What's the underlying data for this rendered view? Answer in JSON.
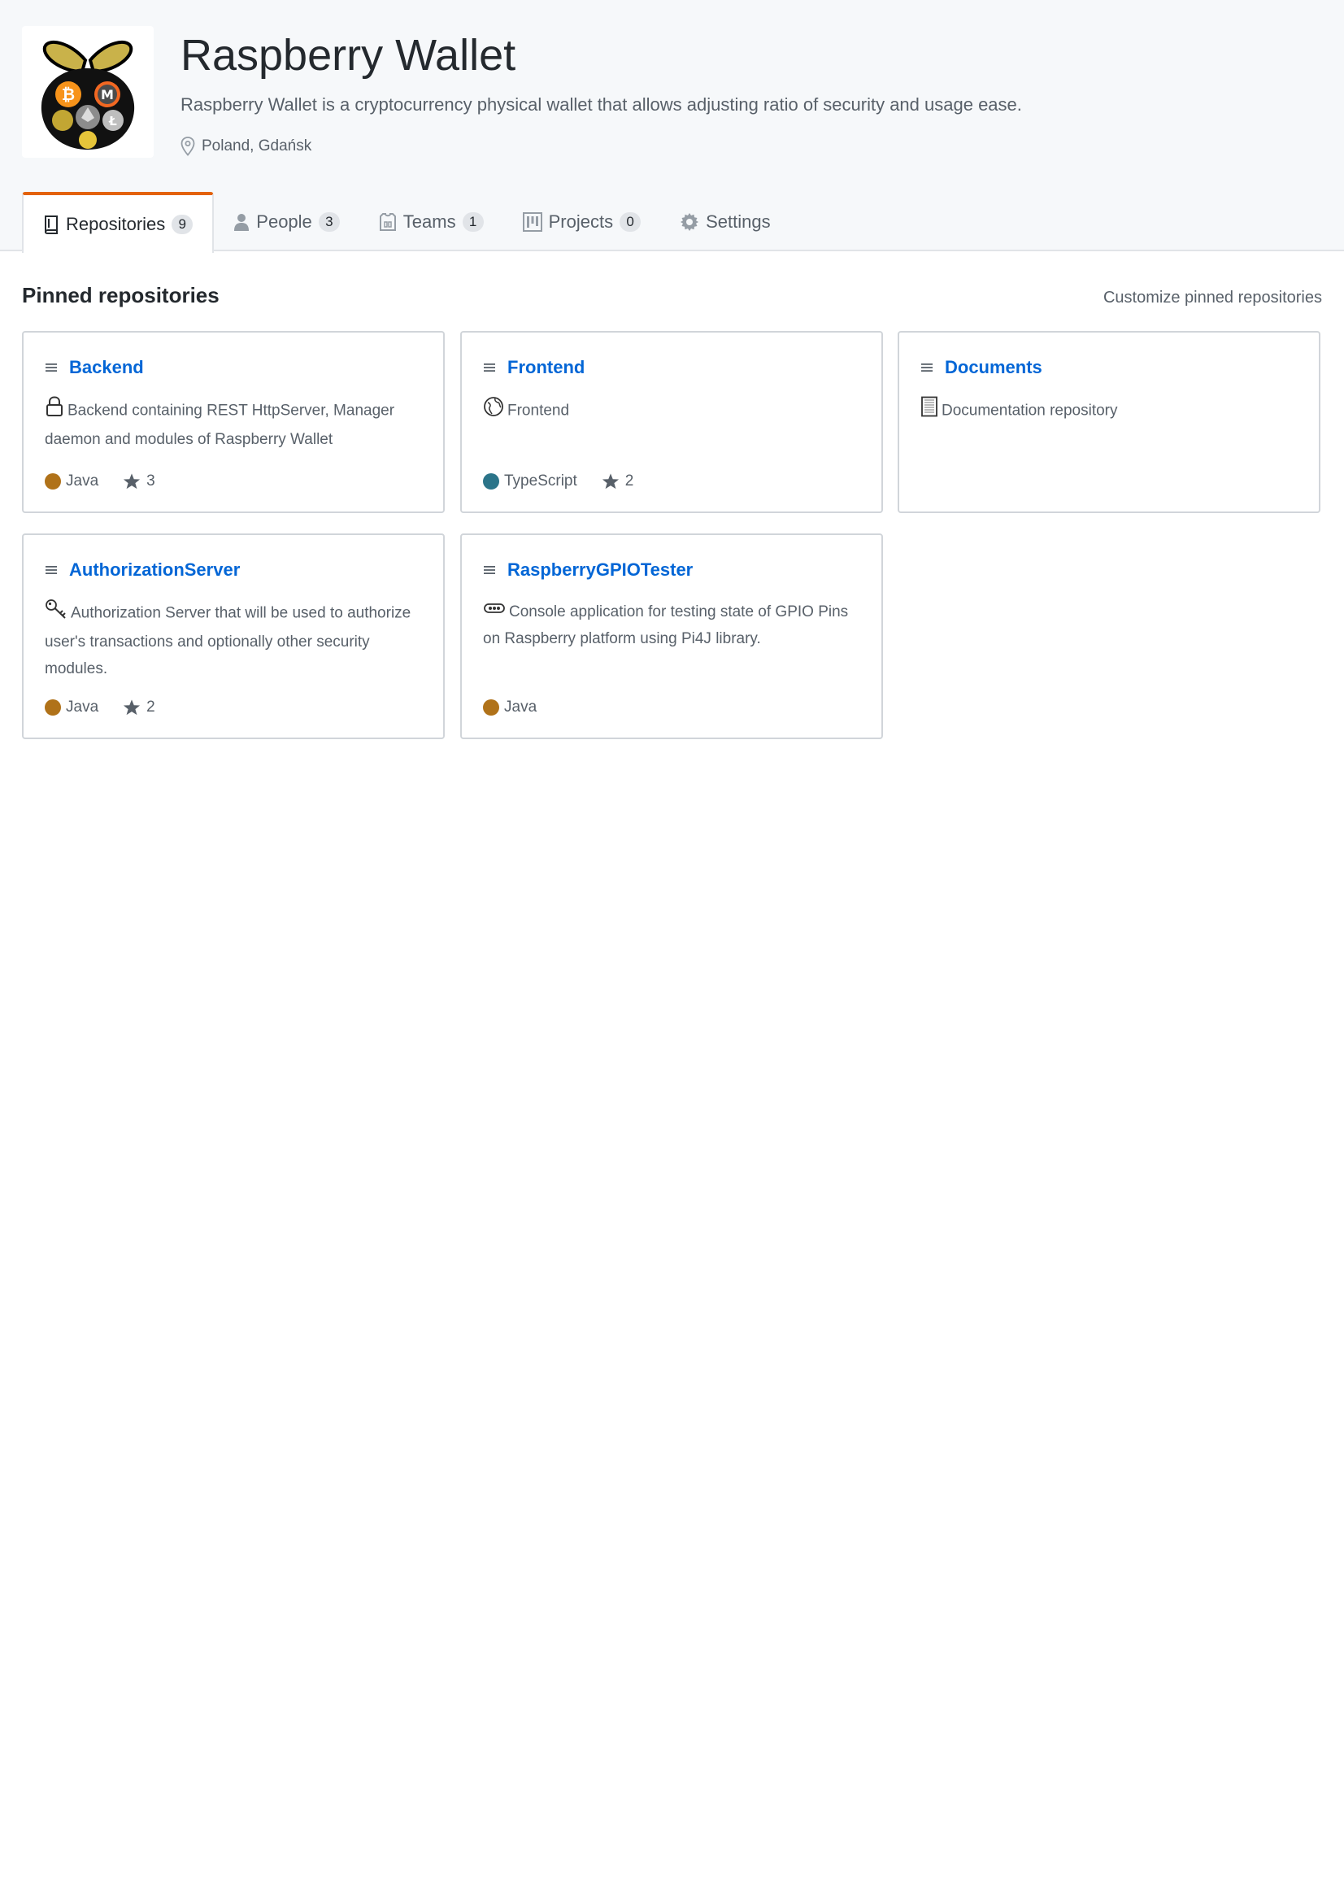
{
  "org": {
    "name": "Raspberry Wallet",
    "description": "Raspberry Wallet is a cryptocurrency physical wallet that allows adjusting ratio of security and usage ease.",
    "location": "Poland, Gdańsk"
  },
  "tabs": [
    {
      "label": "Repositories",
      "count": "9",
      "icon": "repo-icon",
      "selected": true
    },
    {
      "label": "People",
      "count": "3",
      "icon": "person-icon"
    },
    {
      "label": "Teams",
      "count": "1",
      "icon": "jersey-icon"
    },
    {
      "label": "Projects",
      "count": "0",
      "icon": "project-icon"
    },
    {
      "label": "Settings",
      "icon": "gear-icon"
    }
  ],
  "pinned": {
    "heading": "Pinned repositories",
    "customize_label": "Customize pinned repositories",
    "repos": [
      {
        "name": "Backend",
        "emoji": "lock-icon",
        "description": "Backend containing REST HttpServer, Manager daemon and modules of Raspberry Wallet",
        "language": "Java",
        "language_color": "#b07219",
        "stars": "3"
      },
      {
        "name": "Frontend",
        "emoji": "globe-icon",
        "description": "Frontend",
        "language": "TypeScript",
        "language_color": "#2b7489",
        "stars": "2"
      },
      {
        "name": "Documents",
        "emoji": "notebook-icon",
        "description": "Documentation repository"
      },
      {
        "name": "AuthorizationServer",
        "emoji": "key-icon",
        "description": "Authorization Server that will be used to authorize user's transactions and optionally other security modules.",
        "language": "Java",
        "language_color": "#b07219",
        "stars": "2"
      },
      {
        "name": "RaspberryGPIOTester",
        "emoji": "chip-icon",
        "description": "Console application for testing state of GPIO Pins on Raspberry platform using Pi4J library.",
        "language": "Java",
        "language_color": "#b07219"
      }
    ]
  }
}
